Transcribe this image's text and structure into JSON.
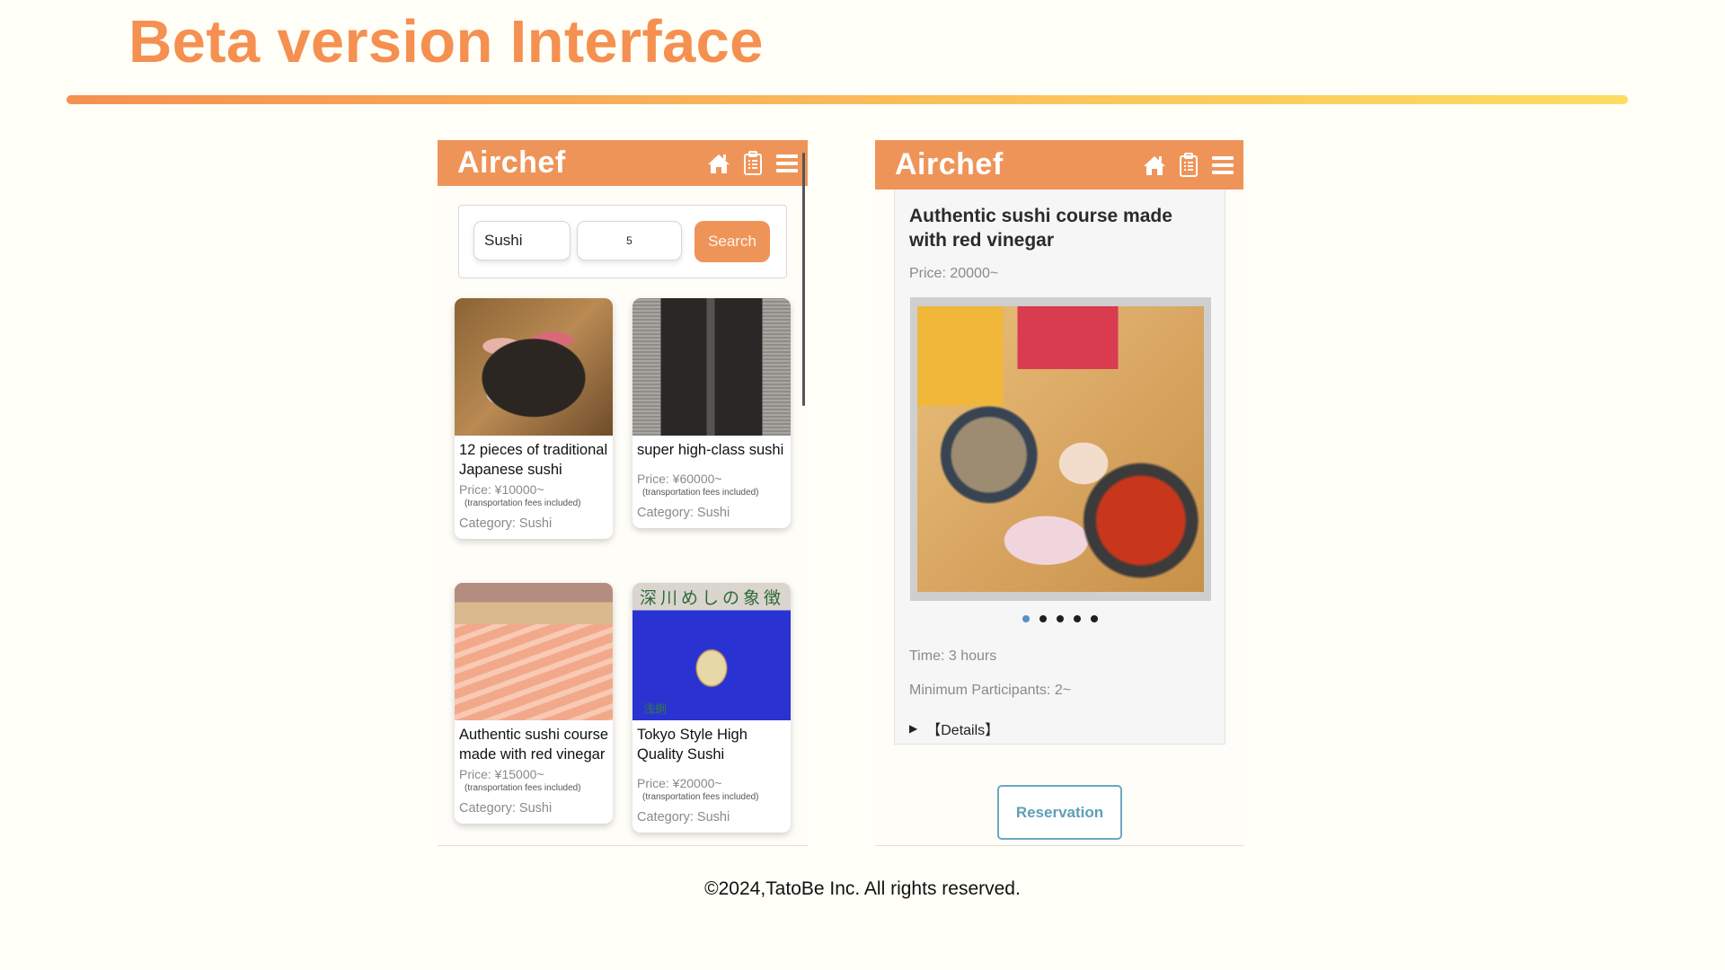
{
  "slide": {
    "title": "Beta version Interface",
    "footer": "©2024,TatoBe Inc. All rights reserved."
  },
  "theme": {
    "accent": "#ef9458",
    "title_color": "#f59050",
    "reserve_color": "#5f9fb8",
    "active_dot": "#5b8ec6"
  },
  "app": {
    "name": "Airchef",
    "icons": [
      "home-icon",
      "clipboard-list-icon",
      "hamburger-menu-icon"
    ]
  },
  "search_screen": {
    "keyword_value": "Sushi",
    "count_value": "5",
    "search_label": "Search",
    "cards": [
      {
        "title": "12 pieces of traditional Japanese sushi",
        "price": "Price: ¥10000~",
        "note": "(transportation fees included)",
        "category": "Category: Sushi"
      },
      {
        "title": "super high-class sushi",
        "price": "Price: ¥60000~",
        "note": "(transportation fees included)",
        "category": "Category: Sushi"
      },
      {
        "title": "Authentic sushi course made with red vinegar",
        "price": "Price: ¥15000~",
        "note": "(transportation fees included)",
        "category": "Category: Sushi"
      },
      {
        "title": "Tokyo Style High Quality Sushi",
        "price": "Price: ¥20000~",
        "note": "(transportation fees included)",
        "category": "Category: Sushi",
        "image_caption": "深川めしの象徴",
        "image_sub_caption": "浅蜊"
      }
    ]
  },
  "detail_screen": {
    "title": "Authentic sushi course made with red vinegar",
    "price": "Price: 20000~",
    "carousel": {
      "total_slides": 5,
      "active_index": 0
    },
    "time": "Time: 3 hours",
    "min_participants": "Minimum Participants: 2~",
    "details_label": "【Details】",
    "reserve_label": "Reservation"
  }
}
